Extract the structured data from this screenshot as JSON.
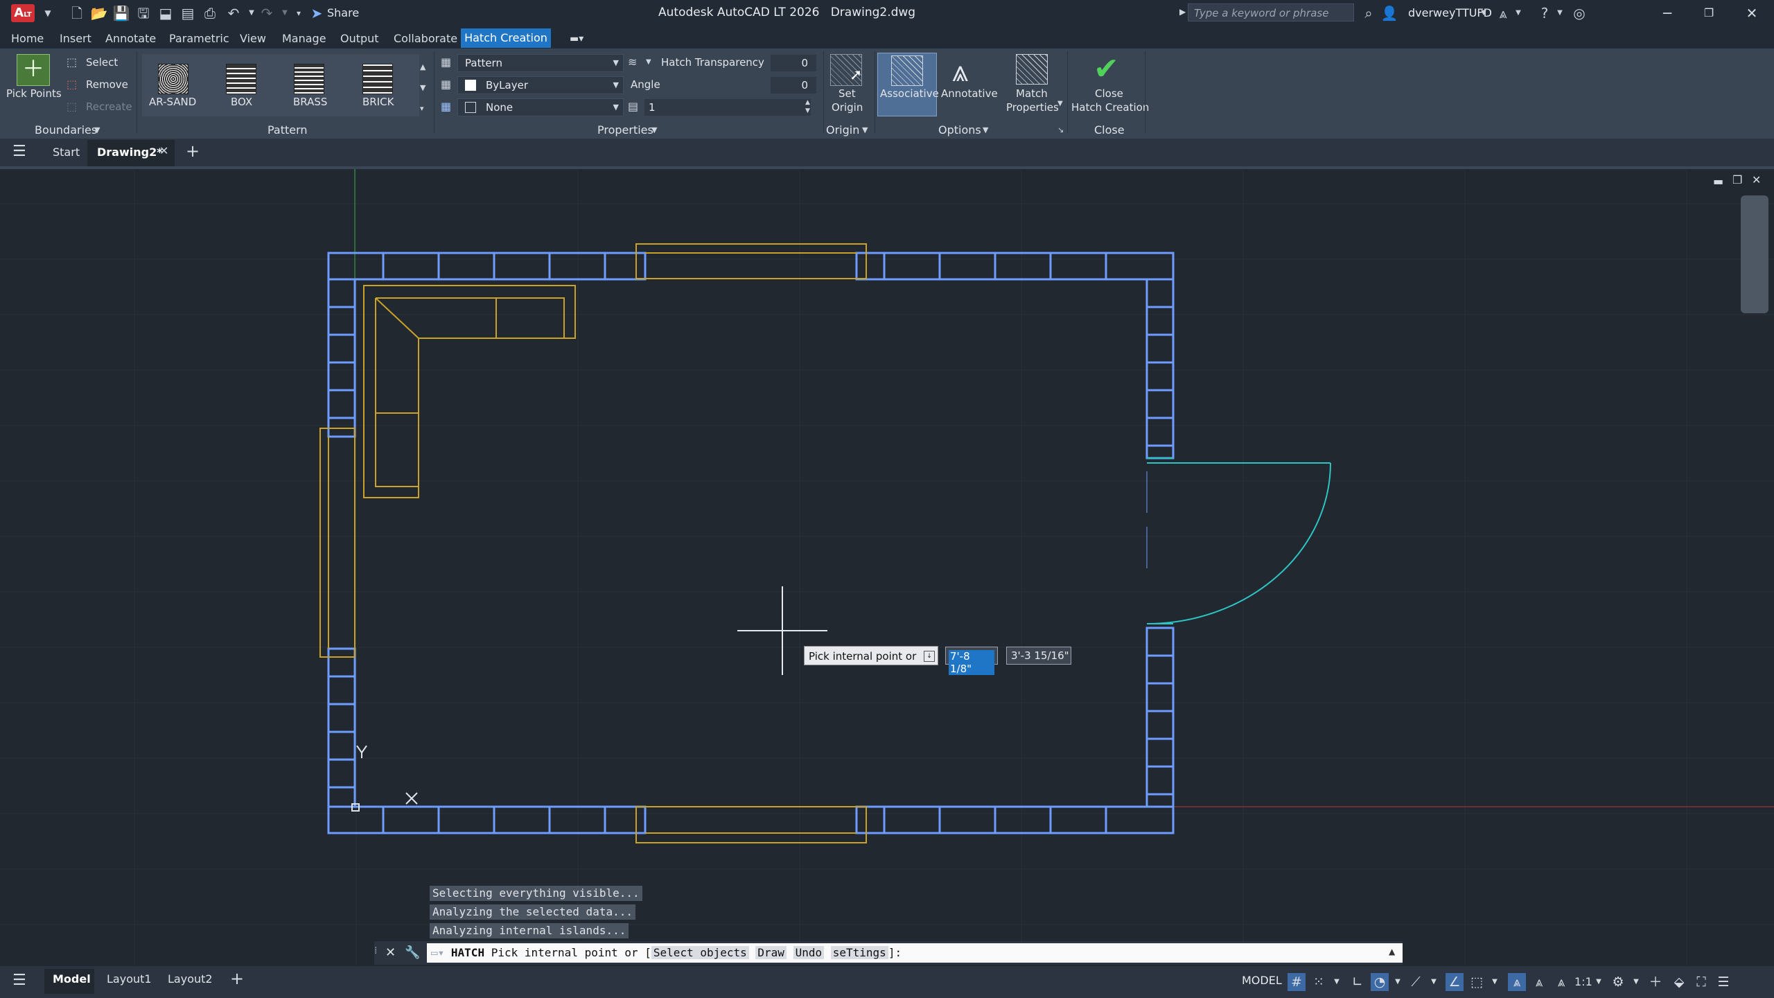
{
  "titlebar": {
    "app_name": "Autodesk AutoCAD LT 2026",
    "file_name": "Drawing2.dwg",
    "logo_text": "A",
    "logo_sub": "LT",
    "share_label": "Share",
    "search_placeholder": "Type a keyword or phrase",
    "user_name": "dverweyTTUFD"
  },
  "menu": {
    "tabs": [
      "Home",
      "Insert",
      "Annotate",
      "Parametric",
      "View",
      "Manage",
      "Output",
      "Collaborate"
    ],
    "active_tab": "Hatch Creation"
  },
  "ribbon": {
    "boundaries": {
      "label": "Boundaries",
      "pick_points": "Pick Points",
      "select": "Select",
      "remove": "Remove",
      "recreate": "Recreate"
    },
    "pattern": {
      "label": "Pattern",
      "items": [
        "AR-SAND",
        "BOX",
        "BRASS",
        "BRICK"
      ]
    },
    "properties": {
      "label": "Properties",
      "type": "Pattern",
      "color": "ByLayer",
      "background": "None",
      "transparency_label": "Hatch Transparency",
      "transparency_value": "0",
      "angle_label": "Angle",
      "angle_value": "0",
      "scale_value": "1"
    },
    "origin": {
      "label": "Origin",
      "set_origin_1": "Set",
      "set_origin_2": "Origin"
    },
    "options": {
      "label": "Options",
      "associative": "Associative",
      "annotative": "Annotative",
      "match_1": "Match",
      "match_2": "Properties"
    },
    "close": {
      "label": "Close",
      "close_1": "Close",
      "close_2": "Hatch Creation"
    }
  },
  "filetabs": {
    "start": "Start",
    "drawing": "Drawing2*"
  },
  "dynamic_input": {
    "prompt": "Pick internal point or",
    "x_value": "7'-8 1/8\"",
    "y_value": "3'-3 15/16\""
  },
  "command": {
    "history": [
      "Selecting everything visible...",
      "Analyzing the selected data...",
      "Analyzing internal islands..."
    ],
    "cmd_name": "HATCH",
    "prompt_text": "Pick internal point or [",
    "options": [
      "Select objects",
      "Draw",
      "Undo",
      "seTtings"
    ],
    "prompt_end": "]:"
  },
  "status": {
    "layouts": [
      "Model",
      "Layout1",
      "Layout2"
    ],
    "model_label": "MODEL",
    "scale_label": "1:1"
  },
  "colors": {
    "wall": "#6e9dff",
    "furniture": "#c9a227",
    "door": "#2fc4c4",
    "accent": "#1f76c7"
  }
}
